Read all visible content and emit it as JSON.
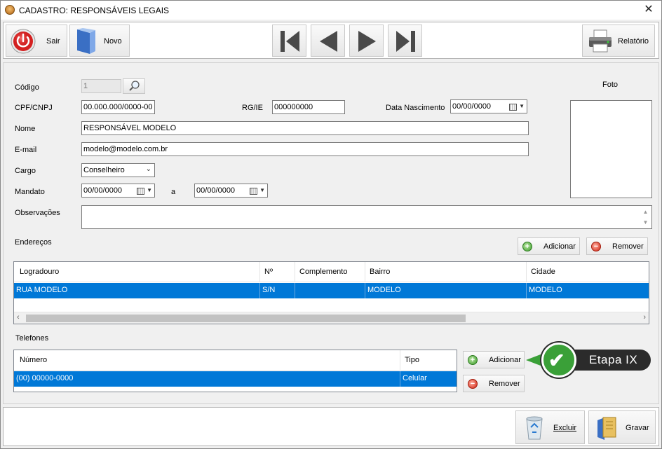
{
  "window": {
    "title": "CADASTRO: RESPONSÁVEIS LEGAIS",
    "close_glyph": "✕"
  },
  "toolbar": {
    "sair_label": "Sair",
    "novo_label": "Novo",
    "relatorio_label": "Relatório",
    "nav": [
      "first-icon",
      "previous-icon",
      "next-icon",
      "last-icon"
    ]
  },
  "form": {
    "codigo": {
      "label": "Código",
      "value": "1"
    },
    "cpf": {
      "label": "CPF/CNPJ",
      "value": "00.000.000/0000-00"
    },
    "rg": {
      "label": "RG/IE",
      "value": "000000000"
    },
    "nascimento": {
      "label": "Data Nascimento",
      "value": "00/00/0000"
    },
    "nome": {
      "label": "Nome",
      "value": "RESPONSÁVEL MODELO"
    },
    "email": {
      "label": "E-mail",
      "value": "modelo@modelo.com.br"
    },
    "cargo": {
      "label": "Cargo",
      "value": "Conselheiro"
    },
    "mandato": {
      "label": "Mandato",
      "from": "00/00/0000",
      "sep": "a",
      "to": "00/00/0000"
    },
    "observacoes": {
      "label": "Observações",
      "value": ""
    },
    "foto_label": "Foto"
  },
  "enderecos": {
    "label": "Endereços",
    "add_label": "Adicionar",
    "remove_label": "Remover",
    "columns": [
      "Logradouro",
      "Nº",
      "Complemento",
      "Bairro",
      "Cidade"
    ],
    "rows": [
      [
        "RUA MODELO",
        "S/N",
        "",
        "MODELO",
        "MODELO"
      ]
    ]
  },
  "telefones": {
    "label": "Telefones",
    "add_label": "Adicionar",
    "remove_label": "Remover",
    "columns": [
      "Número",
      "Tipo"
    ],
    "rows": [
      [
        "(00) 00000-0000",
        "Celular"
      ]
    ]
  },
  "callout": {
    "text": "Etapa IX",
    "color": "#3aa038"
  },
  "footer": {
    "excluir_label": "Excluir",
    "gravar_label": "Gravar"
  },
  "colors": {
    "selection": "#0078d7",
    "accent_green": "#3aa038",
    "close_red": "#d02010"
  }
}
